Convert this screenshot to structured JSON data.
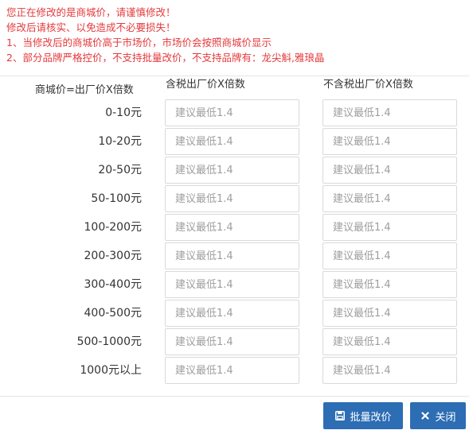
{
  "warnings": [
    "您正在修改的是商城价，请谨慎修改！",
    "修改后请核实、以免造成不必要损失！",
    "1、当修改后的商城价高于市场价，市场价会按照商城价显示",
    "2、部分品牌严格控价，不支持批量改价，不支持品牌有：龙尖斛,雅琅晶"
  ],
  "header": {
    "formula": "商城价=出厂价X倍数",
    "tax_col": "含税出厂价X倍数",
    "notax_col": "不含税出厂价X倍数"
  },
  "rows": [
    {
      "range": "0-10元",
      "tax_placeholder": "建议最低1.4",
      "notax_placeholder": "建议最低1.4"
    },
    {
      "range": "10-20元",
      "tax_placeholder": "建议最低1.4",
      "notax_placeholder": "建议最低1.4"
    },
    {
      "range": "20-50元",
      "tax_placeholder": "建议最低1.4",
      "notax_placeholder": "建议最低1.4"
    },
    {
      "range": "50-100元",
      "tax_placeholder": "建议最低1.4",
      "notax_placeholder": "建议最低1.4"
    },
    {
      "range": "100-200元",
      "tax_placeholder": "建议最低1.4",
      "notax_placeholder": "建议最低1.4"
    },
    {
      "range": "200-300元",
      "tax_placeholder": "建议最低1.4",
      "notax_placeholder": "建议最低1.4"
    },
    {
      "range": "300-400元",
      "tax_placeholder": "建议最低1.4",
      "notax_placeholder": "建议最低1.4"
    },
    {
      "range": "400-500元",
      "tax_placeholder": "建议最低1.4",
      "notax_placeholder": "建议最低1.4"
    },
    {
      "range": "500-1000元",
      "tax_placeholder": "建议最低1.4",
      "notax_placeholder": "建议最低1.4"
    },
    {
      "range": "1000元以上",
      "tax_placeholder": "建议最低1.4",
      "notax_placeholder": "建议最低1.4"
    }
  ],
  "buttons": {
    "batch_label": "批量改价",
    "batch_icon": "save-icon",
    "close_label": "关闭",
    "close_icon": "close-icon"
  },
  "colors": {
    "warning": "#e4393c",
    "button": "#2c6db4"
  }
}
